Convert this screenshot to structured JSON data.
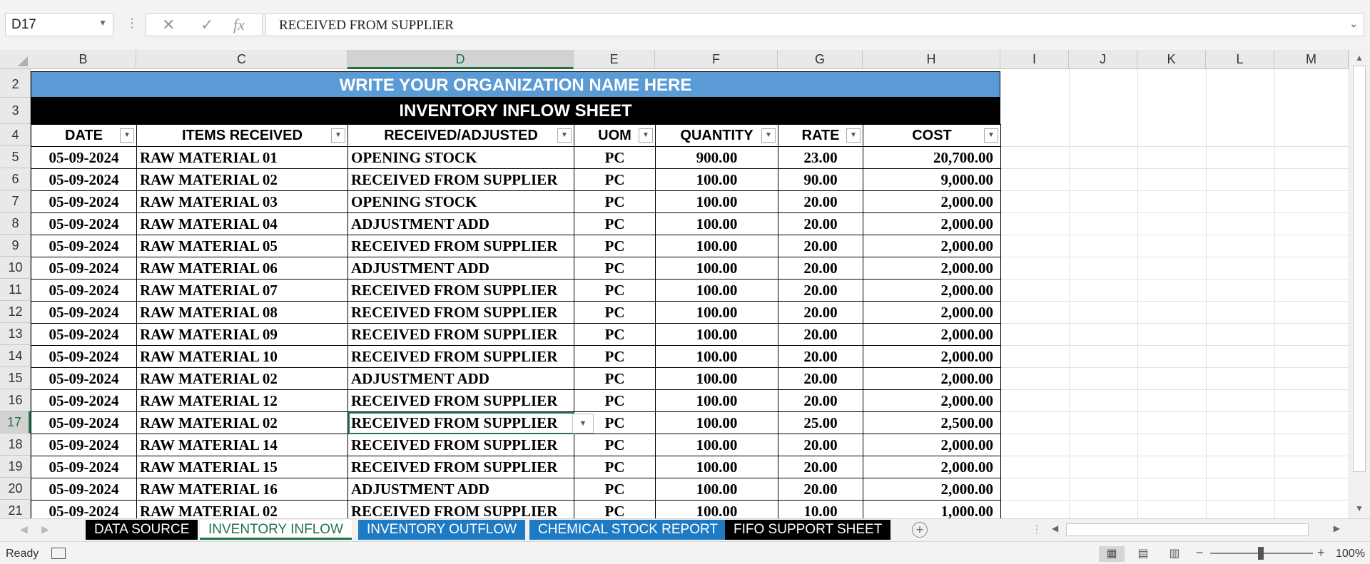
{
  "formula_bar": {
    "name_box": "D17",
    "cancel_icon": "✕",
    "enter_icon": "✓",
    "fx_icon": "fx",
    "content": "RECEIVED FROM SUPPLIER"
  },
  "columns": [
    "B",
    "C",
    "D",
    "E",
    "F",
    "G",
    "H",
    "I",
    "J",
    "K",
    "L",
    "M"
  ],
  "rows": [
    "2",
    "3",
    "4",
    "5",
    "6",
    "7",
    "8",
    "9",
    "10",
    "11",
    "12",
    "13",
    "14",
    "15",
    "16",
    "17",
    "18",
    "19",
    "20",
    "21"
  ],
  "sheet": {
    "org_name": "WRITE YOUR ORGANIZATION NAME HERE",
    "title": "INVENTORY INFLOW SHEET",
    "headers": [
      "DATE",
      "ITEMS RECEIVED",
      "RECEIVED/ADJUSTED",
      "UOM",
      "QUANTITY",
      "RATE",
      "COST"
    ],
    "data": [
      [
        "05-09-2024",
        "RAW MATERIAL 01",
        "OPENING STOCK",
        "PC",
        "900.00",
        "23.00",
        "20,700.00"
      ],
      [
        "05-09-2024",
        "RAW MATERIAL 02",
        "RECEIVED FROM SUPPLIER",
        "PC",
        "100.00",
        "90.00",
        "9,000.00"
      ],
      [
        "05-09-2024",
        "RAW MATERIAL 03",
        "OPENING STOCK",
        "PC",
        "100.00",
        "20.00",
        "2,000.00"
      ],
      [
        "05-09-2024",
        "RAW MATERIAL 04",
        "ADJUSTMENT ADD",
        "PC",
        "100.00",
        "20.00",
        "2,000.00"
      ],
      [
        "05-09-2024",
        "RAW MATERIAL 05",
        "RECEIVED FROM SUPPLIER",
        "PC",
        "100.00",
        "20.00",
        "2,000.00"
      ],
      [
        "05-09-2024",
        "RAW MATERIAL 06",
        "ADJUSTMENT ADD",
        "PC",
        "100.00",
        "20.00",
        "2,000.00"
      ],
      [
        "05-09-2024",
        "RAW MATERIAL 07",
        "RECEIVED FROM SUPPLIER",
        "PC",
        "100.00",
        "20.00",
        "2,000.00"
      ],
      [
        "05-09-2024",
        "RAW MATERIAL 08",
        "RECEIVED FROM SUPPLIER",
        "PC",
        "100.00",
        "20.00",
        "2,000.00"
      ],
      [
        "05-09-2024",
        "RAW MATERIAL 09",
        "RECEIVED FROM SUPPLIER",
        "PC",
        "100.00",
        "20.00",
        "2,000.00"
      ],
      [
        "05-09-2024",
        "RAW MATERIAL 10",
        "RECEIVED FROM SUPPLIER",
        "PC",
        "100.00",
        "20.00",
        "2,000.00"
      ],
      [
        "05-09-2024",
        "RAW MATERIAL 02",
        "ADJUSTMENT ADD",
        "PC",
        "100.00",
        "20.00",
        "2,000.00"
      ],
      [
        "05-09-2024",
        "RAW MATERIAL 12",
        "RECEIVED FROM SUPPLIER",
        "PC",
        "100.00",
        "20.00",
        "2,000.00"
      ],
      [
        "05-09-2024",
        "RAW MATERIAL 02",
        "RECEIVED FROM SUPPLIER",
        "PC",
        "100.00",
        "25.00",
        "2,500.00"
      ],
      [
        "05-09-2024",
        "RAW MATERIAL 14",
        "RECEIVED FROM SUPPLIER",
        "PC",
        "100.00",
        "20.00",
        "2,000.00"
      ],
      [
        "05-09-2024",
        "RAW MATERIAL 15",
        "RECEIVED FROM SUPPLIER",
        "PC",
        "100.00",
        "20.00",
        "2,000.00"
      ],
      [
        "05-09-2024",
        "RAW MATERIAL 16",
        "ADJUSTMENT ADD",
        "PC",
        "100.00",
        "20.00",
        "2,000.00"
      ],
      [
        "05-09-2024",
        "RAW MATERIAL 02",
        "RECEIVED FROM SUPPLIER",
        "PC",
        "100.00",
        "10.00",
        "1,000.00"
      ]
    ]
  },
  "tabs": [
    {
      "label": "DATA SOURCE",
      "style": "black"
    },
    {
      "label": "INVENTORY INFLOW",
      "style": "active"
    },
    {
      "label": "INVENTORY OUTFLOW",
      "style": "blue"
    },
    {
      "label": "CHEMICAL STOCK REPORT",
      "style": "blue"
    },
    {
      "label": "FIFO SUPPORT SHEET",
      "style": "black"
    }
  ],
  "status": {
    "text": "Ready",
    "zoom": "100%"
  },
  "colors": {
    "title_band": "#5b9bd5",
    "accent": "#217346",
    "tab_blue": "#1f7ac4"
  }
}
